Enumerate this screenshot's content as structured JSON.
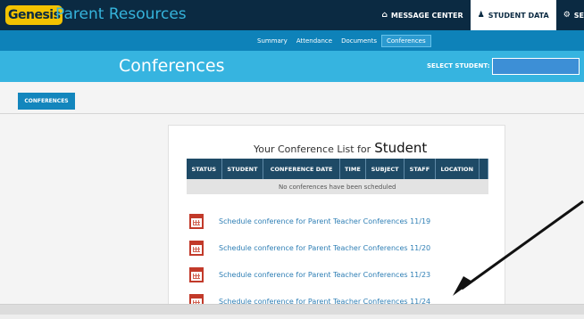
{
  "app": {
    "logo_text": "Genesis",
    "title": "Parent Resources"
  },
  "top_nav": {
    "message_center": "MESSAGE CENTER",
    "student_data": "STUDENT DATA",
    "settings_partial": "SE"
  },
  "sub_nav": [
    "Summary",
    "Attendance",
    "Documents",
    "Conferences"
  ],
  "page": {
    "title": "Conferences",
    "select_student_label": "SELECT STUDENT:"
  },
  "sidebar": {
    "tab_label": "CONFERENCES"
  },
  "card": {
    "title_prefix": "Your Conference List for",
    "student_name": "Student",
    "columns": [
      "STATUS",
      "STUDENT",
      "CONFERENCE DATE",
      "TIME",
      "SUBJECT",
      "STAFF",
      "LOCATION",
      ""
    ],
    "empty_message": "No conferences have been scheduled",
    "schedule_links": [
      "Schedule conference for Parent Teacher Conferences 11/19",
      "Schedule conference for Parent Teacher Conferences 11/20",
      "Schedule conference for Parent Teacher Conferences 11/23",
      "Schedule conference for Parent Teacher Conferences 11/24"
    ]
  },
  "colors": {
    "top_bar": "#0b2a42",
    "sub_nav": "#0e82b9",
    "page_header": "#36b4e0",
    "accent_yellow": "#f2c200",
    "link": "#2f7fb5",
    "calendar_red": "#c23a2a"
  },
  "icons": {
    "message_center": "home-icon",
    "student_data": "users-icon",
    "settings": "gear-icon",
    "schedule": "calendar-icon"
  }
}
